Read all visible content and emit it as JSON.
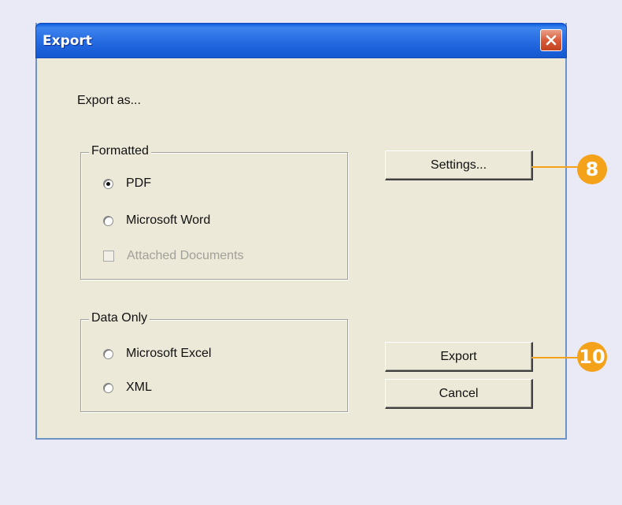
{
  "dialog": {
    "title": "Export",
    "prompt": "Export as..."
  },
  "formatted": {
    "legend": "Formatted",
    "options": [
      {
        "label": "PDF",
        "checked": true
      },
      {
        "label": "Microsoft Word",
        "checked": false
      }
    ],
    "attached_documents": {
      "label": "Attached Documents",
      "disabled": true,
      "checked": false
    }
  },
  "data_only": {
    "legend": "Data Only",
    "options": [
      {
        "label": "Microsoft Excel",
        "checked": false
      },
      {
        "label": "XML",
        "checked": false
      }
    ]
  },
  "buttons": {
    "settings": "Settings...",
    "export": "Export",
    "cancel": "Cancel"
  },
  "callouts": {
    "settings": "8",
    "export": "10",
    "color": "#f5a21b"
  },
  "colors": {
    "titlebar": "#1a5fd8",
    "dialog_bg": "#ece9d8",
    "page_bg": "#e9eaf6",
    "close": "#d85b3a"
  }
}
